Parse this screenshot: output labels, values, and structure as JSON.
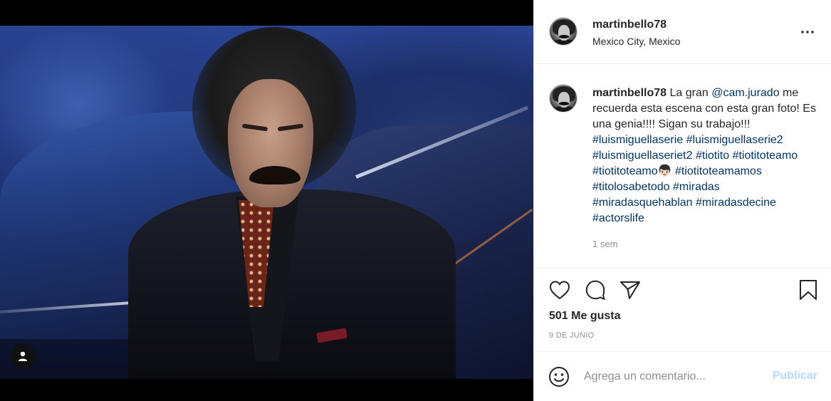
{
  "post": {
    "username": "martinbello78",
    "location": "Mexico City, Mexico",
    "caption": {
      "author": "martinbello78",
      "text_1": "La gran ",
      "mention": "@cam.jurado",
      "text_2": " me recuerda esta escena con esta gran foto! Es una genia!!!! Sigan su trabajo!!! ",
      "hashtags": [
        "#luismiguellaserie",
        "#luismiguellaserie2",
        "#luismiguellaseriet2",
        "#tiotito",
        "#tiotitoteamo",
        "#tiotitoteamo👦🏻",
        "#tiotitoteamamos",
        "#titolosabetodo",
        "#miradas",
        "#miradasquehablan",
        "#miradasdecine",
        "#actorslife"
      ],
      "time_ago": "1 sem"
    },
    "likes": "501 Me gusta",
    "date": "9 DE JUNIO"
  },
  "comment": {
    "placeholder": "Agrega un comentario...",
    "publish_label": "Publicar"
  },
  "icons": {
    "more": "more-horizontal-icon",
    "like": "heart-icon",
    "comment": "comment-bubble-icon",
    "share": "paper-plane-icon",
    "save": "bookmark-icon",
    "emoji": "smiley-icon",
    "user_tag": "user-tag-icon"
  },
  "colors": {
    "link": "#00376b",
    "muted": "#8e8e8e",
    "publish_disabled": "#b3dbff",
    "text": "#262626"
  }
}
